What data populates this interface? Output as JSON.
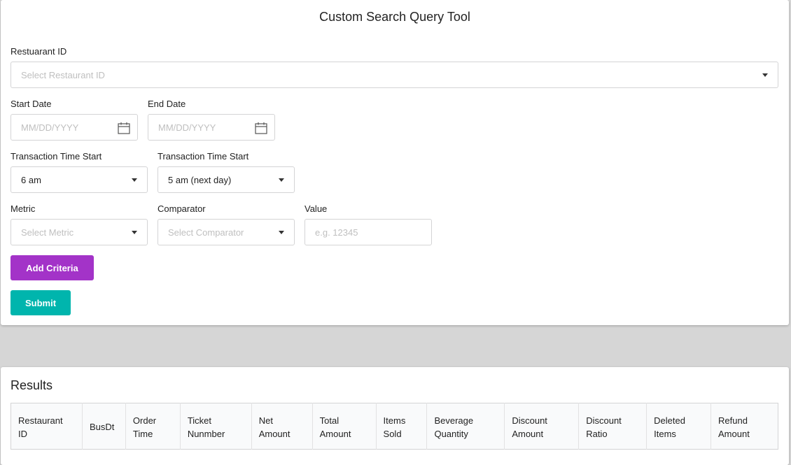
{
  "query_form": {
    "title": "Custom Search Query Tool",
    "restaurant_label": "Restuarant ID",
    "restaurant_placeholder": "Select Restaurant ID",
    "start_date_label": "Start Date",
    "start_date_placeholder": "MM/DD/YYYY",
    "end_date_label": "End Date",
    "end_date_placeholder": "MM/DD/YYYY",
    "time_start_label": "Transaction Time Start",
    "time_start_value": "6 am",
    "time_end_label": "Transaction Time Start",
    "time_end_value": "5 am (next day)",
    "metric_label": "Metric",
    "metric_placeholder": "Select Metric",
    "comparator_label": "Comparator",
    "comparator_placeholder": "Select Comparator",
    "value_label": "Value",
    "value_placeholder": "e.g. 12345",
    "add_criteria_label": "Add Criteria",
    "submit_label": "Submit"
  },
  "results": {
    "title": "Results",
    "columns": [
      [
        "Restaurant",
        "ID"
      ],
      [
        "BusDt"
      ],
      [
        "Order",
        "Time"
      ],
      [
        "Ticket",
        "Nunmber"
      ],
      [
        "Net",
        "Amount"
      ],
      [
        "Total",
        "Amount"
      ],
      [
        "Items",
        "Sold"
      ],
      [
        "Beverage",
        "Quantity"
      ],
      [
        "Discount",
        "Amount"
      ],
      [
        "Discount",
        "Ratio"
      ],
      [
        "Deleted",
        "Items"
      ],
      [
        "Refund",
        "Amount"
      ]
    ]
  },
  "colors": {
    "add_criteria": "#a333c8",
    "submit": "#00b5ad",
    "page_background": "#d6d6d6"
  },
  "icons": [
    "calendar-icon",
    "chevron-down-icon"
  ]
}
